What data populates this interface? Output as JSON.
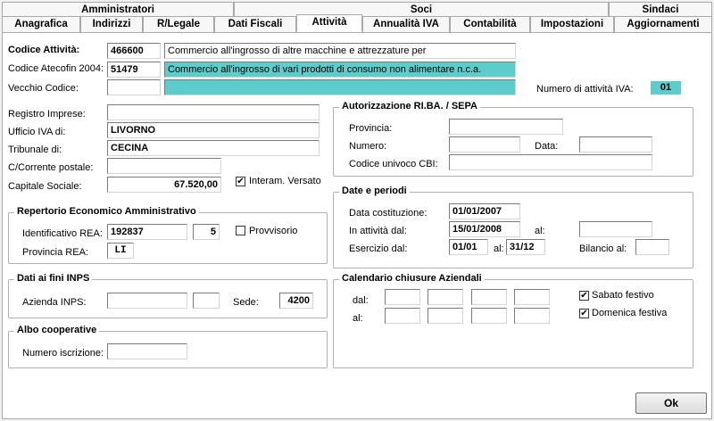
{
  "tabs_top": [
    "Amministratori",
    "Soci",
    "Sindaci"
  ],
  "tabs": [
    "Anagrafica",
    "Indirizzi",
    "R/Legale",
    "Dati Fiscali",
    "Attività",
    "Annualità IVA",
    "Contabilità",
    "Impostazioni",
    "Aggiornamenti"
  ],
  "active_tab": "Attività",
  "codice_attivita": {
    "label": "Codice Attività:",
    "code": "466600",
    "desc": "Commercio all'ingrosso di altre macchine e attrezzature per"
  },
  "codice_atecofin": {
    "label": "Codice Atecofin 2004:",
    "code": "51479",
    "desc": "Commercio all'ingrosso di vari prodotti di consumo non alimentare n.c.a."
  },
  "vecchio_codice": {
    "label": "Vecchio Codice:",
    "code": "",
    "desc": ""
  },
  "numero_attivita": {
    "label": "Numero di attività IVA:",
    "value": "01"
  },
  "registro_imprese": {
    "label": "Registro Imprese:",
    "value": ""
  },
  "ufficio_iva": {
    "label": "Ufficio IVA di:",
    "value": "LIVORNO"
  },
  "tribunale": {
    "label": "Tribunale di:",
    "value": "CECINA"
  },
  "cc_postale": {
    "label": "C/Corrente postale:",
    "value": ""
  },
  "capitale_sociale": {
    "label": "Capitale Sociale:",
    "value": "67.520,00"
  },
  "interam_versato": {
    "label": "Interam. Versato",
    "checked": true
  },
  "rea": {
    "title": "Repertorio Economico Amministrativo",
    "ident_label": "Identificativo REA:",
    "ident_value": "192837",
    "ident_suffix": "5",
    "provvisorio_label": "Provvisorio",
    "provvisorio_checked": false,
    "provincia_label": "Provincia REA:",
    "provincia_value": "LI"
  },
  "inps": {
    "title": "Dati ai fini INPS",
    "azienda_label": "Azienda INPS:",
    "azienda_value": "",
    "azienda_extra": "",
    "sede_label": "Sede:",
    "sede_value": "4200"
  },
  "albo": {
    "title": "Albo cooperative",
    "numero_label": "Numero iscrizione:",
    "numero_value": ""
  },
  "rid": {
    "title": "Autorizzazione RI.BA. / SEPA",
    "provincia_label": "Provincia:",
    "provincia_value": "",
    "numero_label": "Numero:",
    "numero_value": "",
    "data_label": "Data:",
    "data_value": "",
    "cbi_label": "Codice univoco CBI:",
    "cbi_value": ""
  },
  "date": {
    "title": "Date e periodi",
    "costituzione_label": "Data costituzione:",
    "costituzione_value": "01/01/2007",
    "attivita_label": "In attività dal:",
    "attivita_value": "15/01/2008",
    "al_label": "al:",
    "al_value": "",
    "esercizio_label": "Esercizio dal:",
    "esercizio_dal": "01/01",
    "esercizio_al_label": "al:",
    "esercizio_al": "31/12",
    "bilancio_label": "Bilancio al:",
    "bilancio_value": ""
  },
  "calendario": {
    "title": "Calendario chiusure Aziendali",
    "dal_label": "dal:",
    "al_label": "al:",
    "sabato_label": "Sabato festivo",
    "sabato_checked": true,
    "domenica_label": "Domenica festiva",
    "domenica_checked": true
  },
  "ok_label": "Ok"
}
